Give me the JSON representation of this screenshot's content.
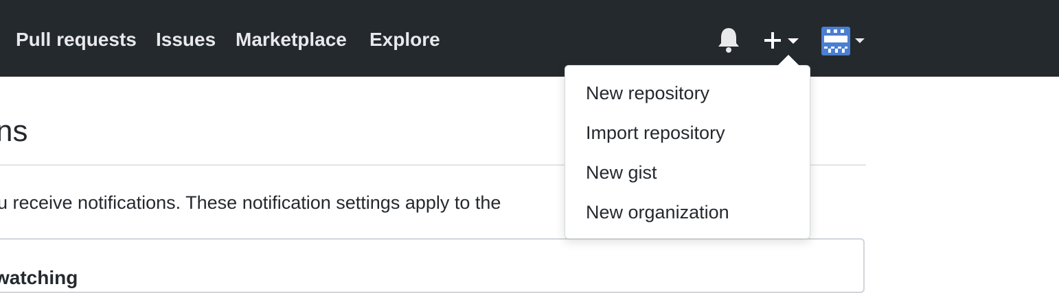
{
  "nav": {
    "links": [
      "Pull requests",
      "Issues",
      "Marketplace",
      "Explore"
    ]
  },
  "header_icons": {
    "notifications": "bell-icon",
    "create": "plus-icon",
    "create_menu": "caret-down-icon",
    "profile": "avatar",
    "profile_menu": "caret-down-icon"
  },
  "colors": {
    "header_bg": "#24292e",
    "nav_text": "#e8e9ea",
    "avatar_blue": "#4a7fd1",
    "border": "#d1d5da"
  },
  "page": {
    "heading": "ns",
    "description": "u receive notifications. These notification settings apply to the",
    "section_title": "watching"
  },
  "create_menu": {
    "items": [
      "New repository",
      "Import repository",
      "New gist",
      "New organization"
    ]
  }
}
